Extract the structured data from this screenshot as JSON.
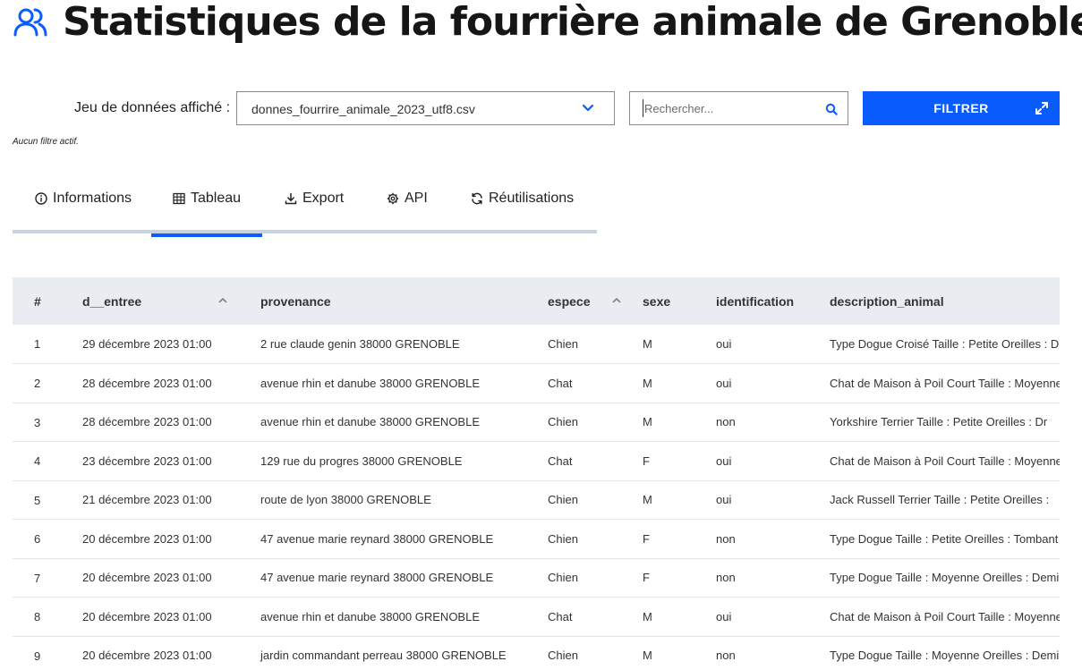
{
  "header": {
    "title": "Statistiques de la fourrière animale de Grenoble",
    "icon": "users-icon"
  },
  "toolbar": {
    "dataset_label": "Jeu de données affiché :",
    "dataset_value": "donnes_fourrire_animale_2023_utf8.csv",
    "search_placeholder": "Rechercher...",
    "filter_label": "FILTRER"
  },
  "status": {
    "no_filter": "Aucun filtre actif."
  },
  "tabs": [
    {
      "label": "Informations",
      "icon": "info-icon"
    },
    {
      "label": "Tableau",
      "icon": "table-icon",
      "active": true
    },
    {
      "label": "Export",
      "icon": "download-icon"
    },
    {
      "label": "API",
      "icon": "gear-icon"
    },
    {
      "label": "Réutilisations",
      "icon": "refresh-icon"
    }
  ],
  "table": {
    "columns": [
      "#",
      "d__entree",
      "provenance",
      "espece",
      "sexe",
      "identification",
      "description_animal"
    ],
    "rows": [
      [
        "1",
        "29 décembre 2023 01:00",
        "2 rue claude genin 38000 GRENOBLE",
        "Chien",
        "M",
        "oui",
        "Type Dogue Croisé Taille : Petite Oreilles : Dr"
      ],
      [
        "2",
        "28 décembre 2023 01:00",
        "avenue rhin et danube 38000 GRENOBLE",
        "Chat",
        "M",
        "oui",
        "Chat de Maison à Poil Court Taille : Moyenne"
      ],
      [
        "3",
        "28 décembre 2023 01:00",
        "avenue rhin et danube 38000 GRENOBLE",
        "Chien",
        "M",
        "non",
        "Yorkshire Terrier Taille : Petite Oreilles : Dr"
      ],
      [
        "4",
        "23 décembre 2023 01:00",
        "129 rue du progres 38000 GRENOBLE",
        "Chat",
        "F",
        "oui",
        "Chat de Maison à Poil Court Taille : Moyenne"
      ],
      [
        "5",
        "21 décembre 2023 01:00",
        "route de lyon 38000 GRENOBLE",
        "Chien",
        "M",
        "oui",
        "Jack Russell Terrier Taille : Petite Oreilles :"
      ],
      [
        "6",
        "20 décembre 2023 01:00",
        "47 avenue marie reynard 38000 GRENOBLE",
        "Chien",
        "F",
        "non",
        "Type Dogue Taille : Petite Oreilles : Tombant"
      ],
      [
        "7",
        "20 décembre 2023 01:00",
        "47 avenue marie reynard 38000 GRENOBLE",
        "Chien",
        "F",
        "non",
        "Type Dogue Taille : Moyenne Oreilles : Demi"
      ],
      [
        "8",
        "20 décembre 2023 01:00",
        "avenue rhin et danube 38000 GRENOBLE",
        "Chat",
        "M",
        "oui",
        "Chat de Maison à Poil Court Taille : Moyenne"
      ],
      [
        "9",
        "20 décembre 2023 01:00",
        "jardin commandant perreau 38000 GRENOBLE",
        "Chien",
        "M",
        "non",
        "Type Dogue Taille : Moyenne Oreilles : Demi"
      ]
    ]
  },
  "colors": {
    "accent": "#0a5cff",
    "tab_underline": "#c7d3e3",
    "header_bg": "#e9ecf1"
  }
}
